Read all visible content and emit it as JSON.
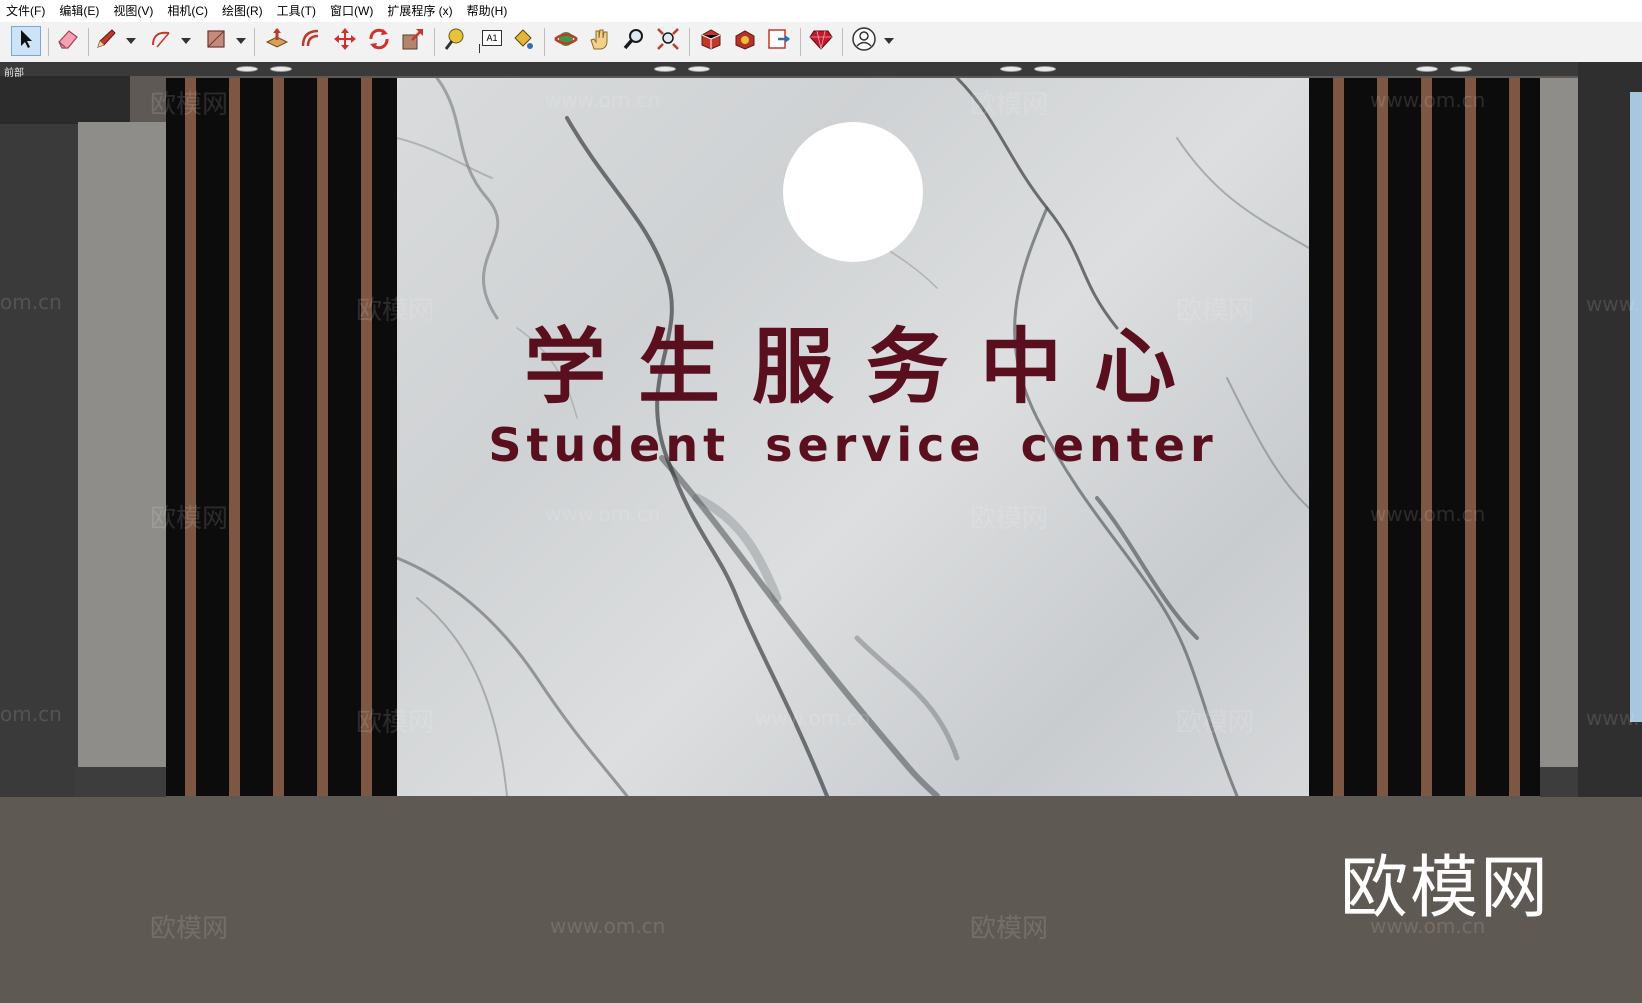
{
  "menubar": {
    "items": [
      {
        "label": "文件(F)"
      },
      {
        "label": "编辑(E)"
      },
      {
        "label": "视图(V)"
      },
      {
        "label": "相机(C)"
      },
      {
        "label": "绘图(R)"
      },
      {
        "label": "工具(T)"
      },
      {
        "label": "窗口(W)"
      },
      {
        "label": "扩展程序 (x)"
      },
      {
        "label": "帮助(H)"
      }
    ]
  },
  "toolbar": {
    "tools": [
      {
        "name": "select-tool",
        "icon": "arrow-pointer-icon",
        "selected": true
      },
      {
        "name": "eraser-tool",
        "icon": "eraser-icon"
      },
      {
        "name": "line-tool",
        "icon": "pencil-icon"
      },
      {
        "name": "arc-tool",
        "icon": "arc-icon"
      },
      {
        "name": "rectangle-tool",
        "icon": "rectangle-icon"
      },
      {
        "name": "push-pull-tool",
        "icon": "push-pull-icon"
      },
      {
        "name": "offset-tool",
        "icon": "offset-icon"
      },
      {
        "name": "move-tool",
        "icon": "move-icon"
      },
      {
        "name": "rotate-tool",
        "icon": "rotate-icon"
      },
      {
        "name": "scale-tool",
        "icon": "scale-icon"
      },
      {
        "name": "tape-measure-tool",
        "icon": "tape-measure-icon"
      },
      {
        "name": "text-tool",
        "icon": "text-icon"
      },
      {
        "name": "paint-bucket-tool",
        "icon": "paint-bucket-icon"
      },
      {
        "name": "orbit-tool",
        "icon": "orbit-icon"
      },
      {
        "name": "pan-tool",
        "icon": "hand-icon"
      },
      {
        "name": "zoom-tool",
        "icon": "magnifier-icon"
      },
      {
        "name": "zoom-extents-tool",
        "icon": "zoom-extents-icon"
      },
      {
        "name": "warehouse-tool",
        "icon": "warehouse-icon"
      },
      {
        "name": "extension-warehouse-tool",
        "icon": "extension-warehouse-icon"
      },
      {
        "name": "send-to-layout-tool",
        "icon": "layout-icon"
      },
      {
        "name": "ruby-console-tool",
        "icon": "ruby-icon"
      },
      {
        "name": "account-tool",
        "icon": "user-icon"
      }
    ],
    "text_tool_glyph": "A1"
  },
  "viewport": {
    "scene_label": "前部",
    "sign": {
      "title_zh": "学生服务中心",
      "title_en": "Student service center",
      "text_color": "#5a0f1f"
    },
    "watermarks": {
      "site": "www.om.cn",
      "brand": "欧模网",
      "site_partial": "om.cn",
      "site_partial_right": "www."
    },
    "brand_overlay": "欧模网"
  },
  "colors": {
    "slat_wood": "#7b5744",
    "slat_black": "#0c0c0c",
    "floor": "#5f5953",
    "side_panel": "#8e8d89",
    "toolbar_bg": "#f2f2f2",
    "selected_tool_bg": "#cde3f7"
  }
}
